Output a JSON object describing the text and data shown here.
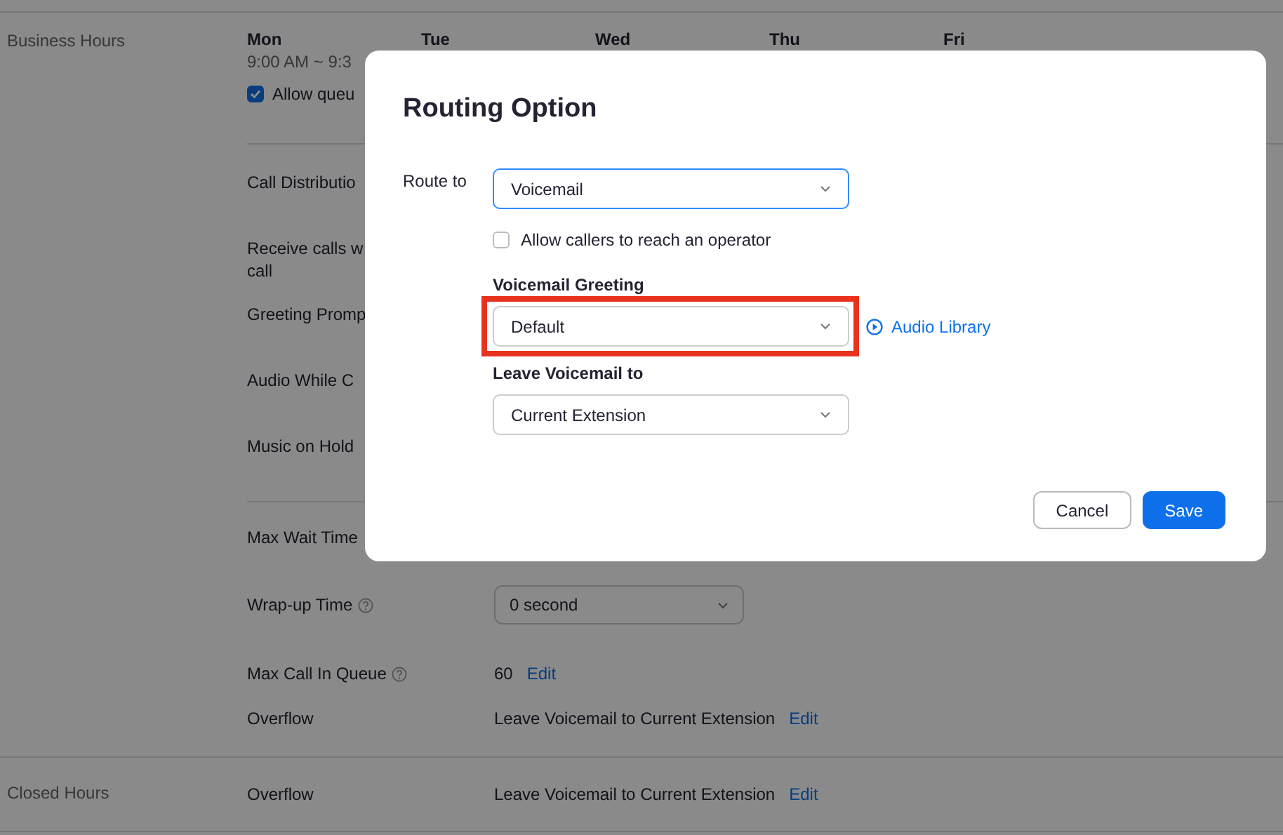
{
  "business_hours": {
    "label": "Business Hours",
    "days": [
      {
        "name": "Mon",
        "hours": "9:00 AM ~ 9:3"
      },
      {
        "name": "Tue"
      },
      {
        "name": "Wed"
      },
      {
        "name": "Thu"
      },
      {
        "name": "Fri"
      }
    ],
    "allow_queue": {
      "label": "Allow queu",
      "checked": true
    },
    "settings": [
      {
        "lines": [
          "Call Distributio"
        ]
      },
      {
        "lines": [
          "Receive calls w",
          "call"
        ]
      },
      {
        "lines": [
          "Greeting Promp"
        ]
      },
      {
        "lines": [
          "Audio While C"
        ]
      },
      {
        "lines": [
          "Music on Hold"
        ]
      }
    ],
    "queue_settings": [
      {
        "label": "Max Wait Time",
        "help": false,
        "kind": "none"
      },
      {
        "label": "Wrap-up Time",
        "help": true,
        "kind": "select",
        "value": "0 second"
      },
      {
        "label": "Max Call In Queue",
        "help": true,
        "kind": "edit",
        "value": "60",
        "action": "Edit"
      },
      {
        "label": "Overflow",
        "help": false,
        "kind": "edit",
        "value": "Leave Voicemail to Current Extension",
        "action": "Edit"
      }
    ]
  },
  "closed_hours": {
    "label": "Closed Hours",
    "settings": [
      {
        "label": "Overflow",
        "help": false,
        "kind": "edit",
        "value": "Leave Voicemail to Current Extension",
        "action": "Edit"
      }
    ]
  },
  "dialog": {
    "title": "Routing Option",
    "route_to": {
      "label": "Route to",
      "value": "Voicemail",
      "focused": true
    },
    "operator": {
      "label": "Allow callers to reach an operator",
      "checked": false
    },
    "greeting": {
      "label": "Voicemail Greeting",
      "value": "Default",
      "highlighted": true,
      "link": "Audio Library"
    },
    "leave_to": {
      "label": "Leave Voicemail to",
      "value": "Current Extension"
    },
    "buttons": [
      {
        "label": "Cancel",
        "kind": "secondary"
      },
      {
        "label": "Save",
        "kind": "primary"
      }
    ]
  }
}
